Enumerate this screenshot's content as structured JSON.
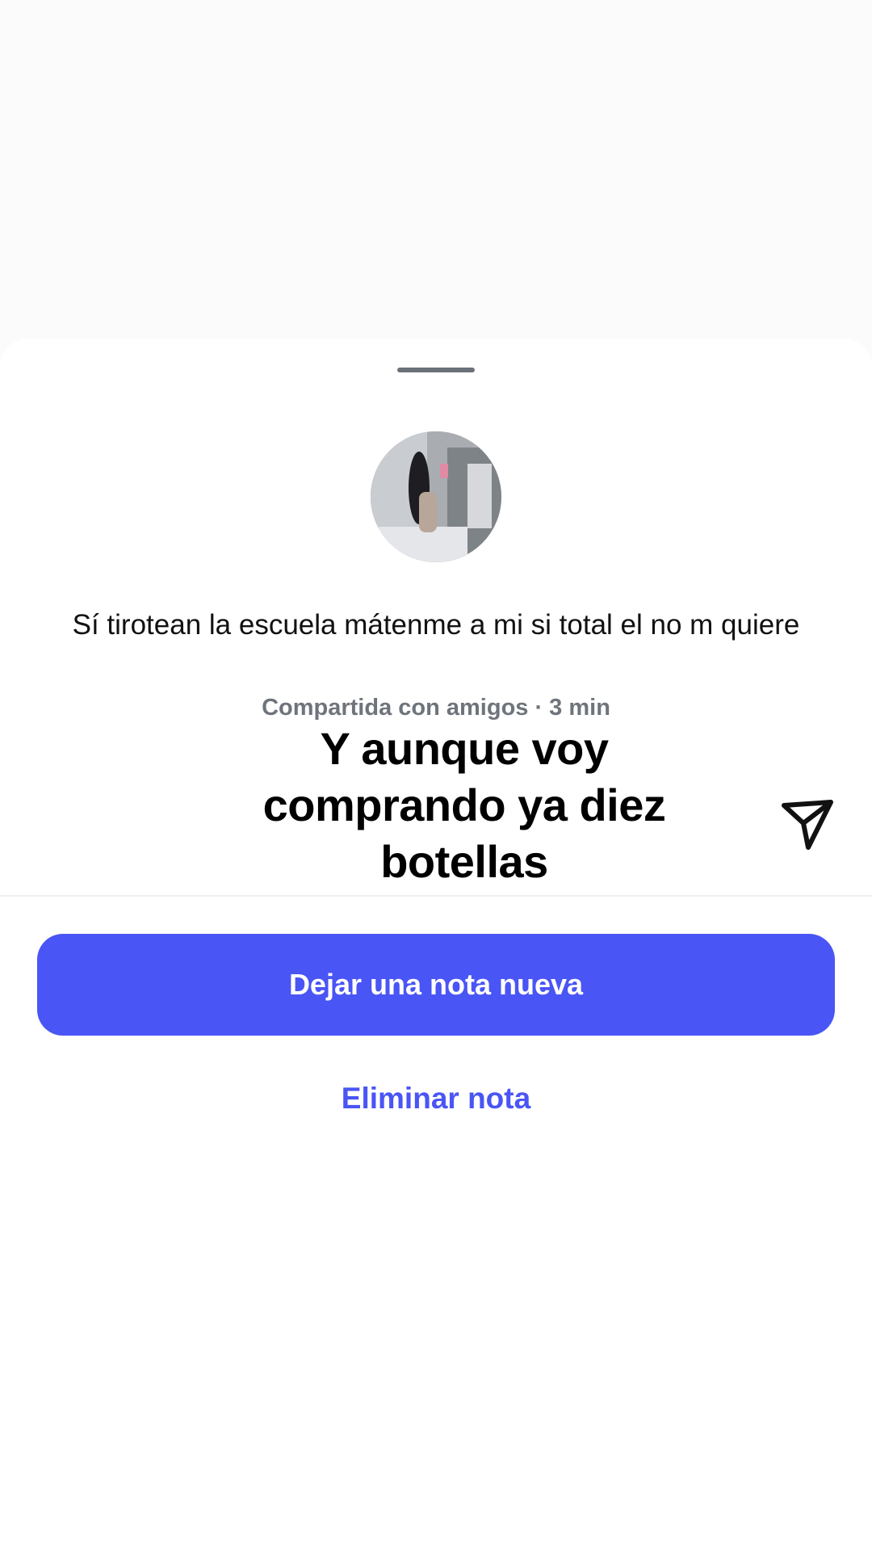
{
  "note": {
    "text": "Sí tirotean la escuela mátenme a mi si total el no m quiere",
    "meta": "Compartida con amigos · 3 min"
  },
  "caption": {
    "text": "Y aunque voy comprando ya diez botellas"
  },
  "actions": {
    "new_note_label": "Dejar una nota nueva",
    "delete_note_label": "Eliminar nota"
  },
  "icons": {
    "send": "send-icon",
    "avatar": "profile-photo"
  },
  "colors": {
    "accent": "#4a55f5",
    "meta_text": "#6f747c",
    "handle": "#6b7079"
  }
}
